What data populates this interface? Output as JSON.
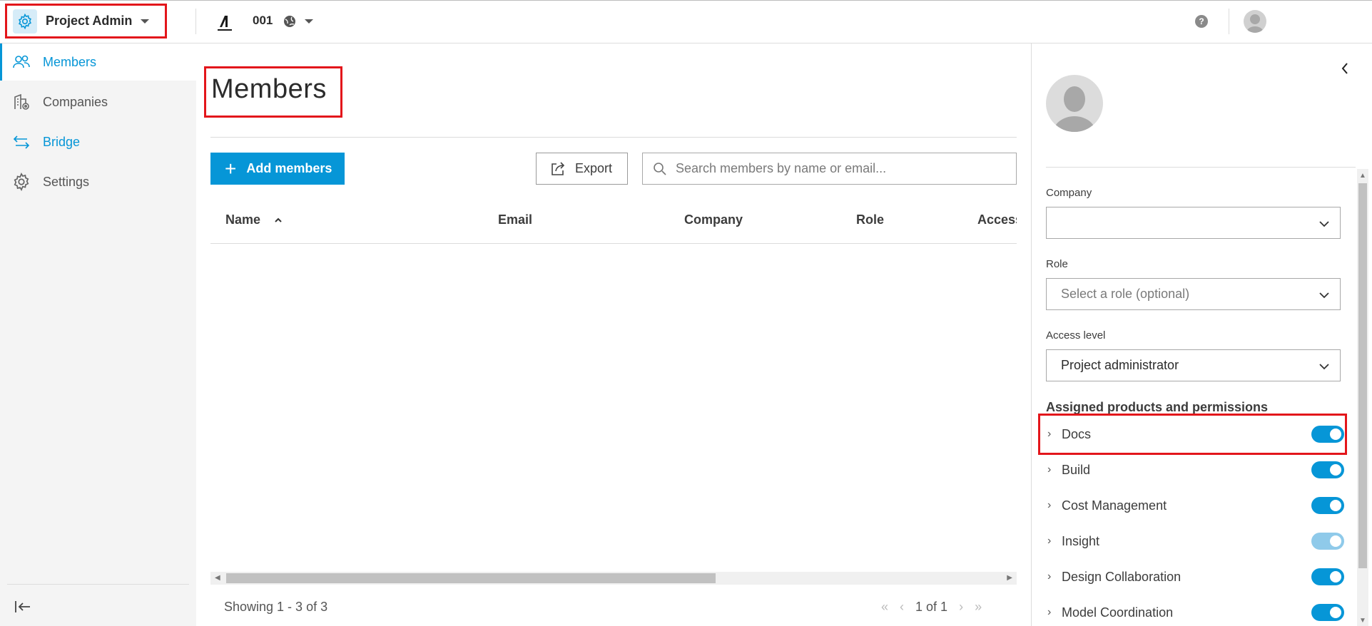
{
  "colors": {
    "accent": "#0696d7",
    "annotation_red": "#e3161b",
    "toggle_dim": "#8fcaea"
  },
  "header": {
    "module_label": "Project Admin",
    "module_icon": "gear-icon",
    "project_name": "001",
    "help_glyph": "?"
  },
  "sidebar": {
    "items": [
      {
        "label": "Members",
        "icon": "people-icon",
        "state": "active"
      },
      {
        "label": "Companies",
        "icon": "building-icon"
      },
      {
        "label": "Bridge",
        "icon": "bridge-arrows-icon"
      },
      {
        "label": "Settings",
        "icon": "gear-icon"
      }
    ],
    "collapse_icon": "collapse-left-icon"
  },
  "main": {
    "title": "Members",
    "add_button": "Add members",
    "add_plus": "+",
    "export_button": "Export",
    "search_placeholder": "Search members by name or email...",
    "columns": [
      "Name",
      "Email",
      "Company",
      "Role",
      "Access l"
    ],
    "sort_indicator": "^",
    "showing": "Showing 1 - 3 of 3",
    "pager": {
      "first": "«",
      "prev": "‹",
      "page_text": "1 of 1",
      "next": "›",
      "last": "»"
    }
  },
  "panel": {
    "company_label": "Company",
    "company_value": "",
    "role_label": "Role",
    "role_placeholder": "Select a role (optional)",
    "access_label": "Access level",
    "access_value": "Project administrator",
    "products_title": "Assigned products and permissions",
    "products": [
      {
        "name": "Docs",
        "enabled": true
      },
      {
        "name": "Build",
        "enabled": true
      },
      {
        "name": "Cost Management",
        "enabled": true
      },
      {
        "name": "Insight",
        "enabled": true,
        "dimmed": true
      },
      {
        "name": "Design Collaboration",
        "enabled": true
      },
      {
        "name": "Model Coordination",
        "enabled": true
      }
    ]
  }
}
